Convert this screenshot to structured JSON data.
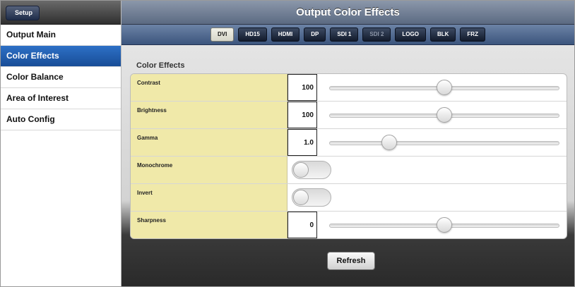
{
  "sidebar": {
    "back_label": "Setup",
    "items": [
      {
        "label": "Output Main",
        "active": false
      },
      {
        "label": "Color Effects",
        "active": true
      },
      {
        "label": "Color Balance",
        "active": false
      },
      {
        "label": "Area of Interest",
        "active": false
      },
      {
        "label": "Auto Config",
        "active": false
      }
    ]
  },
  "header": {
    "title": "Output Color Effects"
  },
  "tabs": [
    {
      "label": "DVI",
      "state": "active"
    },
    {
      "label": "HD15",
      "state": "normal"
    },
    {
      "label": "HDMI",
      "state": "normal"
    },
    {
      "label": "DP",
      "state": "normal"
    },
    {
      "label": "SDI 1",
      "state": "normal"
    },
    {
      "label": "SDI 2",
      "state": "disabled"
    },
    {
      "label": "LOGO",
      "state": "normal"
    },
    {
      "label": "BLK",
      "state": "normal"
    },
    {
      "label": "FRZ",
      "state": "normal"
    }
  ],
  "section_title": "Color Effects",
  "settings": {
    "contrast": {
      "label": "Contrast",
      "value": "100",
      "slider_fraction": 0.5
    },
    "brightness": {
      "label": "Brightness",
      "value": "100",
      "slider_fraction": 0.5
    },
    "gamma": {
      "label": "Gamma",
      "value": "1.0",
      "slider_fraction": 0.26
    },
    "monochrome": {
      "label": "Monochrome",
      "on": false
    },
    "invert": {
      "label": "Invert",
      "on": false
    },
    "sharpness": {
      "label": "Sharpness",
      "value": "0",
      "slider_fraction": 0.5
    }
  },
  "refresh_label": "Refresh",
  "colors": {
    "sidebar_active": "#1f5db0",
    "label_bg": "#f0e9a9",
    "title_bar": "#6b7a91"
  }
}
